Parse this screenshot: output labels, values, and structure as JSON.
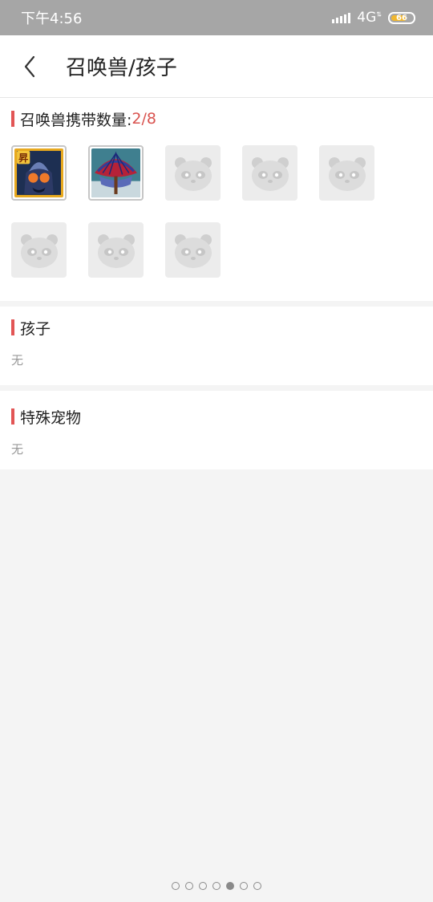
{
  "status": {
    "time": "下午4:56",
    "network": "4G",
    "battery": "66"
  },
  "header": {
    "title": "召唤兽/孩子"
  },
  "summons": {
    "label": "召唤兽携带数量: ",
    "count": "2/8",
    "slots": [
      {
        "filled": true,
        "icon": "armored-beast-pet-icon"
      },
      {
        "filled": true,
        "icon": "umbrella-pet-icon"
      },
      {
        "filled": false,
        "icon": "panda-placeholder-icon"
      },
      {
        "filled": false,
        "icon": "panda-placeholder-icon"
      },
      {
        "filled": false,
        "icon": "panda-placeholder-icon"
      },
      {
        "filled": false,
        "icon": "panda-placeholder-icon"
      },
      {
        "filled": false,
        "icon": "panda-placeholder-icon"
      },
      {
        "filled": false,
        "icon": "panda-placeholder-icon"
      }
    ]
  },
  "children": {
    "label": "孩子",
    "value": "无"
  },
  "special": {
    "label": "特殊宠物",
    "value": "无"
  },
  "pager": {
    "total": 7,
    "active": 5
  },
  "colors": {
    "accent": "#e25555",
    "statusbar": "#a6a6a6",
    "page_bg": "#f4f4f4"
  }
}
